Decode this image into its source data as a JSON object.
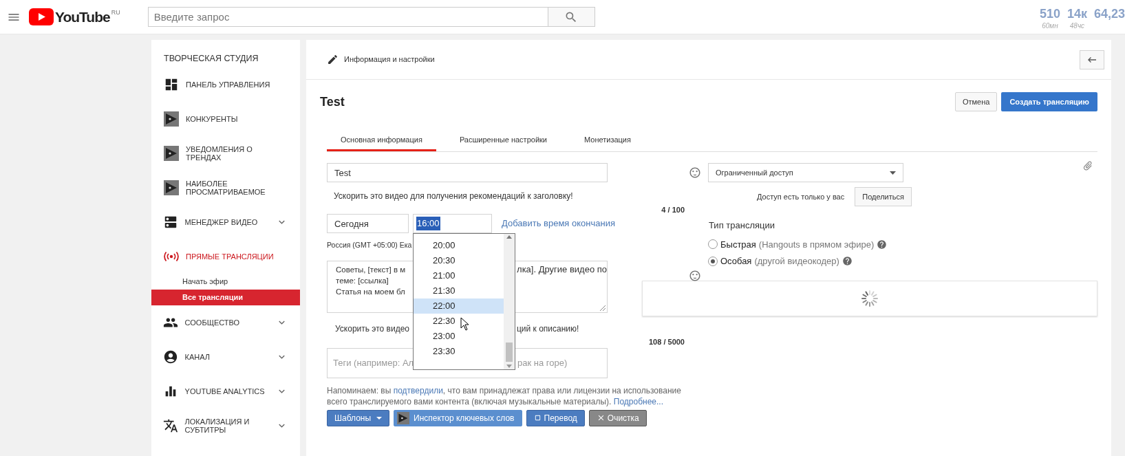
{
  "header": {
    "logo_text": "YouTube",
    "region": "RU",
    "search": {
      "placeholder": "Введите запрос"
    },
    "stats": [
      {
        "value": "510",
        "caption": "60мн"
      },
      {
        "value": "14к",
        "caption": "48чс"
      },
      {
        "value": "64,23"
      }
    ]
  },
  "sidebar": {
    "title": "ТВОРЧЕСКАЯ СТУДИЯ",
    "items": [
      {
        "label": "ПАНЕЛЬ УПРАВЛЕНИЯ",
        "expandable": false,
        "selected": false
      },
      {
        "label": "КОНКУРЕНТЫ",
        "expandable": false,
        "selected": false
      },
      {
        "label": "УВЕДОМЛЕНИЯ О ТРЕНДАХ",
        "expandable": false,
        "selected": false
      },
      {
        "label": "НАИБОЛЕЕ ПРОСМАТРИВАЕМОЕ",
        "expandable": false,
        "selected": false
      },
      {
        "label": "МЕНЕДЖЕР ВИДЕО",
        "expandable": true,
        "selected": false
      },
      {
        "label": "ПРЯМЫЕ ТРАНСЛЯЦИИ",
        "expandable": false,
        "selected": true,
        "children": [
          {
            "label": "Начать эфир",
            "selected": false
          },
          {
            "label": "Все трансляции",
            "selected": true
          }
        ]
      },
      {
        "label": "СООБЩЕСТВО",
        "expandable": true,
        "selected": false
      },
      {
        "label": "КАНАЛ",
        "expandable": true,
        "selected": false
      },
      {
        "label": "YOUTUBE ANALYTICS",
        "expandable": true,
        "selected": false
      },
      {
        "label": "ЛОКАЛИЗАЦИЯ И СУБТИТРЫ",
        "expandable": true,
        "selected": false
      }
    ]
  },
  "page": {
    "section_title": "Информация и настройки",
    "title": "Test",
    "buttons": [
      {
        "label": "Отмена",
        "kind": "secondary"
      },
      {
        "label": "Создать трансляцию",
        "kind": "primary"
      }
    ],
    "tabs": [
      {
        "label": "Основная информация",
        "selected": true
      },
      {
        "label": "Расширенные настройки",
        "selected": false
      },
      {
        "label": "Монетизация",
        "selected": false
      }
    ]
  },
  "form": {
    "title_input": {
      "value": "Test"
    },
    "title_hint": "Ускорить это видео для получения рекомендаций к заголовку!",
    "title_counter": "4 / 100",
    "date": {
      "value": "Сегодня"
    },
    "time": {
      "value": "16:00",
      "open": true,
      "options": [
        {
          "label": "20:00",
          "selected": false
        },
        {
          "label": "20:30",
          "selected": false
        },
        {
          "label": "21:00",
          "selected": false
        },
        {
          "label": "21:30",
          "selected": false
        },
        {
          "label": "22:00",
          "selected": true
        },
        {
          "label": "22:30",
          "selected": false
        },
        {
          "label": "23:00",
          "selected": false
        },
        {
          "label": "23:30",
          "selected": false
        }
      ]
    },
    "end_time_link": "Добавить время окончания",
    "timezone": "Россия (GMT +05:00) Ека",
    "description": {
      "left_lines": [
        "Советы, [текст] в м",
        "теме: [ссылка]",
        "Статья на моем бл"
      ],
      "right_lines": [
        "лка]. Другие видео по"
      ]
    },
    "description_hint": {
      "left": "Ускорить это видео",
      "right": "ций к описанию!"
    },
    "description_counter": "108 / 5000",
    "tags": {
      "placeholder_left": "Теги (например: Ал",
      "placeholder_right": "рак на горе)"
    },
    "notice": {
      "before": "Напоминаем: вы ",
      "link": "подтвердили",
      "middle": ", что вам принадлежат права или лицензии на использование всего транслируемого вами контента (включая музыкальные материалы). ",
      "more_link": "Подробнее..."
    },
    "tool_buttons": [
      {
        "label": "Шаблоны",
        "kind": "dropdown"
      },
      {
        "label": "Инспектор ключевых слов",
        "kind": "logo"
      },
      {
        "label": "Перевод",
        "kind": "translate"
      },
      {
        "label": "Очистка",
        "kind": "clear"
      }
    ]
  },
  "privacy": {
    "value": "Ограниченный доступ",
    "note": "Доступ есть только у вас",
    "share_button": "Поделиться"
  },
  "broadcast_type": {
    "title": "Тип трансляции",
    "options": [
      {
        "label": "Быстрая",
        "hint": "(Hangouts в прямом эфире)",
        "selected": false
      },
      {
        "label": "Особая",
        "hint": "(другой видеокодер)",
        "selected": true
      }
    ]
  }
}
